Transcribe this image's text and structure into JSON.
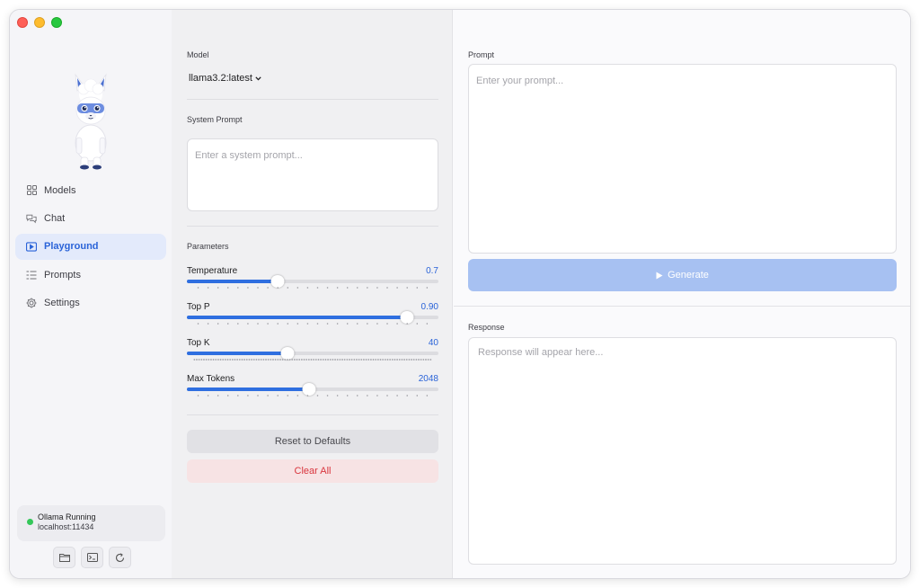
{
  "window": {
    "traffic_lights": [
      "close",
      "minimize",
      "zoom"
    ]
  },
  "sidebar": {
    "mascot": "llama-mascot",
    "items": [
      {
        "label": "Models",
        "icon": "grid-icon",
        "active": false
      },
      {
        "label": "Chat",
        "icon": "chat-bubbles-icon",
        "active": false
      },
      {
        "label": "Playground",
        "icon": "play-rect-icon",
        "active": true
      },
      {
        "label": "Prompts",
        "icon": "list-icon",
        "active": false
      },
      {
        "label": "Settings",
        "icon": "gear-icon",
        "active": false
      }
    ],
    "status": {
      "title": "Ollama Running",
      "host": "localhost:11434",
      "color": "#34c759"
    },
    "footer_icons": [
      "folder-icon",
      "terminal-icon",
      "refresh-icon"
    ]
  },
  "panel": {
    "model_label": "Model",
    "model_value": "llama3.2:latest",
    "system_prompt_label": "System Prompt",
    "system_prompt_placeholder": "Enter a system prompt...",
    "parameters_label": "Parameters",
    "params": [
      {
        "name": "Temperature",
        "value": "0.7",
        "fraction": 0.36
      },
      {
        "name": "Top P",
        "value": "0.90",
        "fraction": 0.875
      },
      {
        "name": "Top K",
        "value": "40",
        "fraction": 0.4
      },
      {
        "name": "Max Tokens",
        "value": "2048",
        "fraction": 0.485
      }
    ],
    "reset_label": "Reset to Defaults",
    "clear_label": "Clear All"
  },
  "main": {
    "prompt_label": "Prompt",
    "prompt_placeholder": "Enter your prompt...",
    "generate_label": "Generate",
    "response_label": "Response",
    "response_placeholder": "Response will appear here..."
  },
  "colors": {
    "accent": "#2f6fe0",
    "active_bg": "#e3eafb",
    "danger": "#d9363e"
  }
}
